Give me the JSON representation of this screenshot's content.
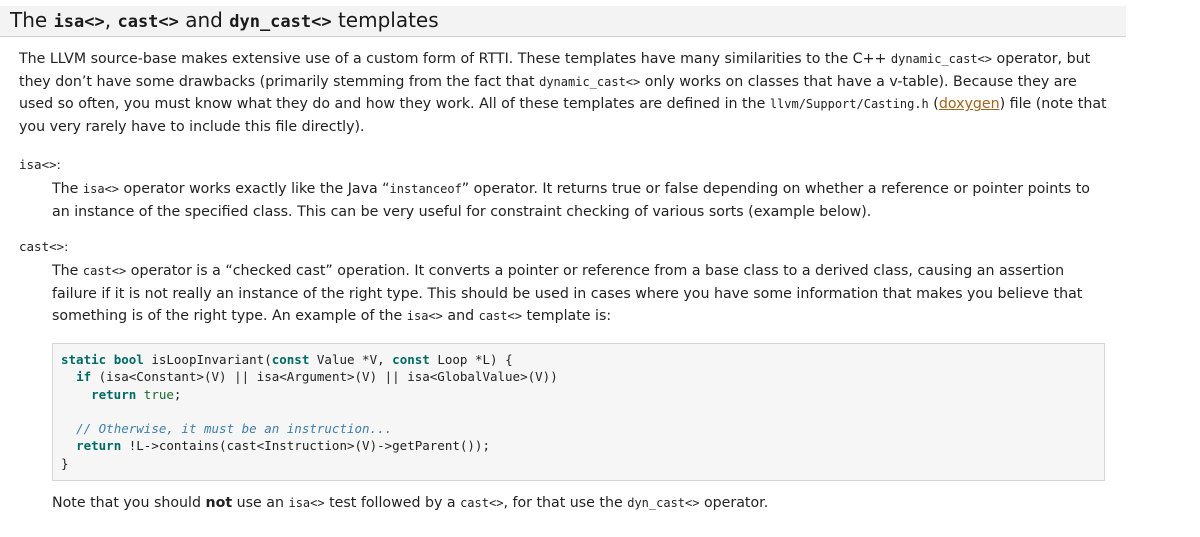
{
  "heading": {
    "prefix": "The ",
    "isa": "isa<>",
    "sep1": ", ",
    "cast": "cast<>",
    "sep2": " and ",
    "dyn_cast": "dyn_cast<>",
    "suffix": " templates"
  },
  "intro": {
    "t1": "The LLVM source-base makes extensive use of a custom form of RTTI. These templates have many similarities to the C++ ",
    "c1": "dynamic_cast<>",
    "t2": " operator, but they don’t have some drawbacks (primarily stemming from the fact that ",
    "c2": "dynamic_cast<>",
    "t3": " only works on classes that have a v-table). Because they are used so often, you must know what they do and how they work. All of these templates are defined in the ",
    "c3": "llvm/Support/Casting.h",
    "t4": " ",
    "link_open": "(",
    "link": "doxygen",
    "t5": ") file (note that you very rarely have to include this file directly)."
  },
  "isa_section": {
    "term": "isa<>",
    "colon": ":",
    "t1": "The ",
    "c1": "isa<>",
    "t2": " operator works exactly like the Java “",
    "c2": "instanceof",
    "t3": "” operator. It returns true or false depending on whether a reference or pointer points to an instance of the specified class. This can be very useful for constraint checking of various sorts (example below)."
  },
  "cast_section": {
    "term": "cast<>",
    "colon": ":",
    "t1": "The ",
    "c1": "cast<>",
    "t2": " operator is a “checked cast” operation. It converts a pointer or reference from a base class to a derived class, causing an assertion failure if it is not really an instance of the right type. This should be used in cases where you have some information that makes you believe that something is of the right type. An example of the ",
    "c2": "isa<>",
    "t3": " and ",
    "c3": "cast<>",
    "t4": " template is:"
  },
  "code": {
    "l1_kw1": "static",
    "l1_kw2": "bool",
    "l1_rest1": " isLoopInvariant(",
    "l1_kw3": "const",
    "l1_rest2": " Value *V, ",
    "l1_kw4": "const",
    "l1_rest3": " Loop *L) {",
    "l2_kw": "if",
    "l2_rest": " (isa<Constant>(V) || isa<Argument>(V) || isa<GlobalValue>(V))",
    "l3_kw": "return",
    "l3_val": "true",
    "l3_end": ";",
    "l5_comment": "// Otherwise, it must be an instruction...",
    "l6_kw": "return",
    "l6_rest": " !L->contains(cast<Instruction>(V)->getParent());",
    "l7": "}"
  },
  "note": {
    "t1": "Note that you should ",
    "bold": "not",
    "t2": " use an ",
    "c1": "isa<>",
    "t3": " test followed by a ",
    "c2": "cast<>",
    "t4": ", for that use the ",
    "c3": "dyn_cast<>",
    "t5": " operator."
  }
}
